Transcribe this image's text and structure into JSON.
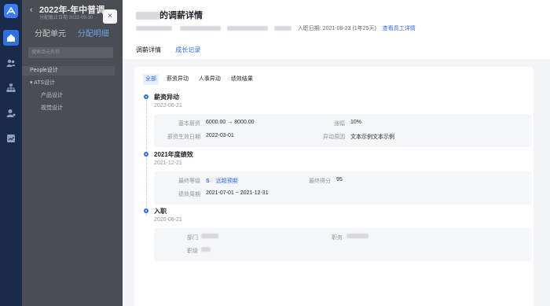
{
  "background_app": {
    "title": "2022年-年中普调",
    "subtitle": "分配截止日期 2022-09-30",
    "tabs": [
      "分配单元",
      "分配明细"
    ],
    "search_placeholder": "搜索单元名称",
    "tree": [
      "People设计",
      "ATS设计",
      "产品设计",
      "视觉设计"
    ]
  },
  "close_label": "×",
  "drawer": {
    "title_suffix": "的调薪详情",
    "hire_date_label": "入职日期: 2021-08-23 (1年25天)",
    "view_employee_link": "查看员工详情",
    "tabs": [
      "调薪详情",
      "成长记录"
    ],
    "active_tab": "成长记录",
    "filters": [
      "全部",
      "薪资异动",
      "人事异动",
      "绩效结果"
    ],
    "active_filter": "全部",
    "sections": {
      "salary": {
        "title": "薪资异动",
        "date": "2022-06-21",
        "base_salary_label": "基本薪资",
        "base_salary_value": "6000.00 → 8000.00",
        "increase_label": "涨幅",
        "increase_value": "10%",
        "effective_label": "薪资生效日期",
        "effective_value": "2022-03-01",
        "reason_label": "异动原因",
        "reason_value": "文本示例文本示例"
      },
      "performance": {
        "title": "2021年度绩效",
        "date": "2021-12-21",
        "grade_label": "最终等级",
        "grade_value": "S",
        "grade_note": "远超预期",
        "score_label": "最终得分",
        "score_value": "95",
        "period_label": "绩效周期",
        "period_value": "2021-07-01 ~ 2021-12-31"
      },
      "hire": {
        "title": "入职",
        "date": "2020-06-21",
        "dept_label": "部门",
        "position_label": "职务",
        "level_label": "职级"
      }
    }
  },
  "colors": {
    "accent": "#2b6bf3",
    "rail": "#1a2b4a",
    "overlay": "#4a4d52"
  }
}
